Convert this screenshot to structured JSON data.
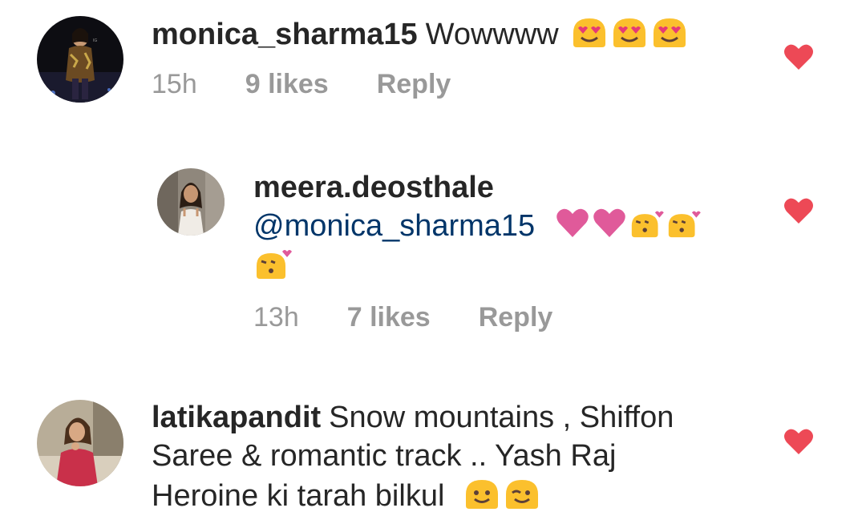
{
  "comments": [
    {
      "username": "monica_sharma15",
      "text": "Wowwww",
      "emoji": [
        "heart-eyes-icon",
        "heart-eyes-icon",
        "heart-eyes-icon"
      ],
      "time": "15h",
      "likes": "9 likes",
      "reply": "Reply",
      "liked": true
    },
    {
      "username": "meera.deosthale",
      "mention": "@monica_sharma15",
      "emoji": [
        "pink-heart-icon",
        "pink-heart-icon",
        "kiss-face-icon",
        "kiss-face-icon",
        "kiss-face-icon"
      ],
      "time": "13h",
      "likes": "7 likes",
      "reply": "Reply",
      "liked": true
    },
    {
      "username": "latikapandit",
      "text_lines": [
        "Snow mountains , Shiffon",
        "Saree & romantic track .. Yash Raj",
        "Heroine ki tarah bilkul"
      ],
      "emoji": [
        "smile-face-icon",
        "wink-face-icon"
      ],
      "liked": true
    }
  ],
  "colors": {
    "text": "#262626",
    "meta": "#999999",
    "mention": "#003569",
    "like_heart": "#ed4956",
    "emoji_yellow": "#fbc02d",
    "emoji_pink_heart": "#e05a9a"
  }
}
